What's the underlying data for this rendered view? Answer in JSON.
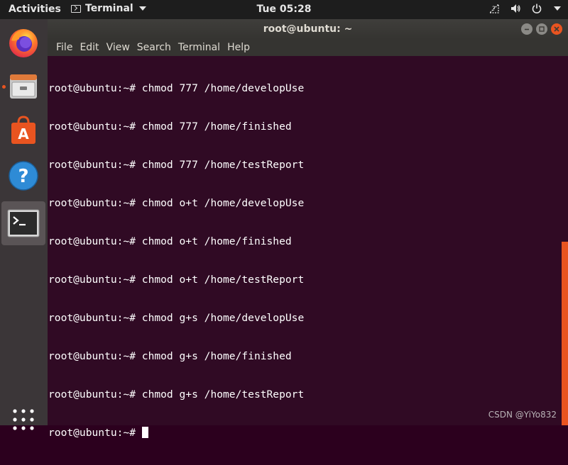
{
  "topbar": {
    "activities": "Activities",
    "app_name": "Terminal",
    "clock": "Tue 05:28",
    "tray_icons": [
      "network-icon",
      "volume-icon",
      "power-icon"
    ]
  },
  "dock": {
    "items": [
      {
        "name": "Firefox",
        "icon": "firefox-icon",
        "running": false
      },
      {
        "name": "Files",
        "icon": "files-icon",
        "running": true
      },
      {
        "name": "Ubuntu Software",
        "icon": "software-icon",
        "running": false
      },
      {
        "name": "Help",
        "icon": "help-icon",
        "running": false
      },
      {
        "name": "Terminal",
        "icon": "terminal-icon",
        "running": true,
        "active": true
      }
    ],
    "show_apps_icon": "app-grid-icon"
  },
  "window": {
    "title": "root@ubuntu: ~",
    "menu": [
      "File",
      "Edit",
      "View",
      "Search",
      "Terminal",
      "Help"
    ]
  },
  "terminal": {
    "lines": [
      "root@ubuntu:~# chmod 777 /home/developUse",
      "root@ubuntu:~# chmod 777 /home/finished",
      "root@ubuntu:~# chmod 777 /home/testReport",
      "root@ubuntu:~# chmod o+t /home/developUse",
      "root@ubuntu:~# chmod o+t /home/finished",
      "root@ubuntu:~# chmod o+t /home/testReport",
      "root@ubuntu:~# chmod g+s /home/developUse",
      "root@ubuntu:~# chmod g+s /home/finished",
      "root@ubuntu:~# chmod g+s /home/testReport"
    ],
    "prompt": "root@ubuntu:~# ",
    "background": "#300a24",
    "foreground": "#ffffff"
  },
  "watermark": "CSDN @YiYo832",
  "colors": {
    "accent": "#e95420",
    "dock_bg": "#3b3638",
    "topbar_bg": "#1d1d1d"
  }
}
